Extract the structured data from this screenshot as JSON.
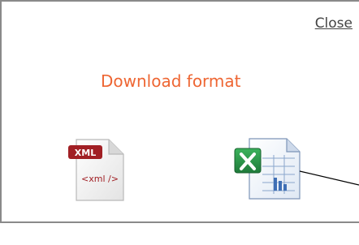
{
  "dialog": {
    "close_label": "Close",
    "title": "Download format"
  },
  "formats": [
    {
      "badge": "XML",
      "tag_text": "<xml />",
      "icon": "xml-file-icon"
    },
    {
      "icon": "excel-file-icon"
    }
  ],
  "colors": {
    "title": "#ee6633",
    "xml_badge": "#a11f24",
    "excel_green": "#1f7a3a",
    "excel_blue": "#3f6fb5"
  }
}
